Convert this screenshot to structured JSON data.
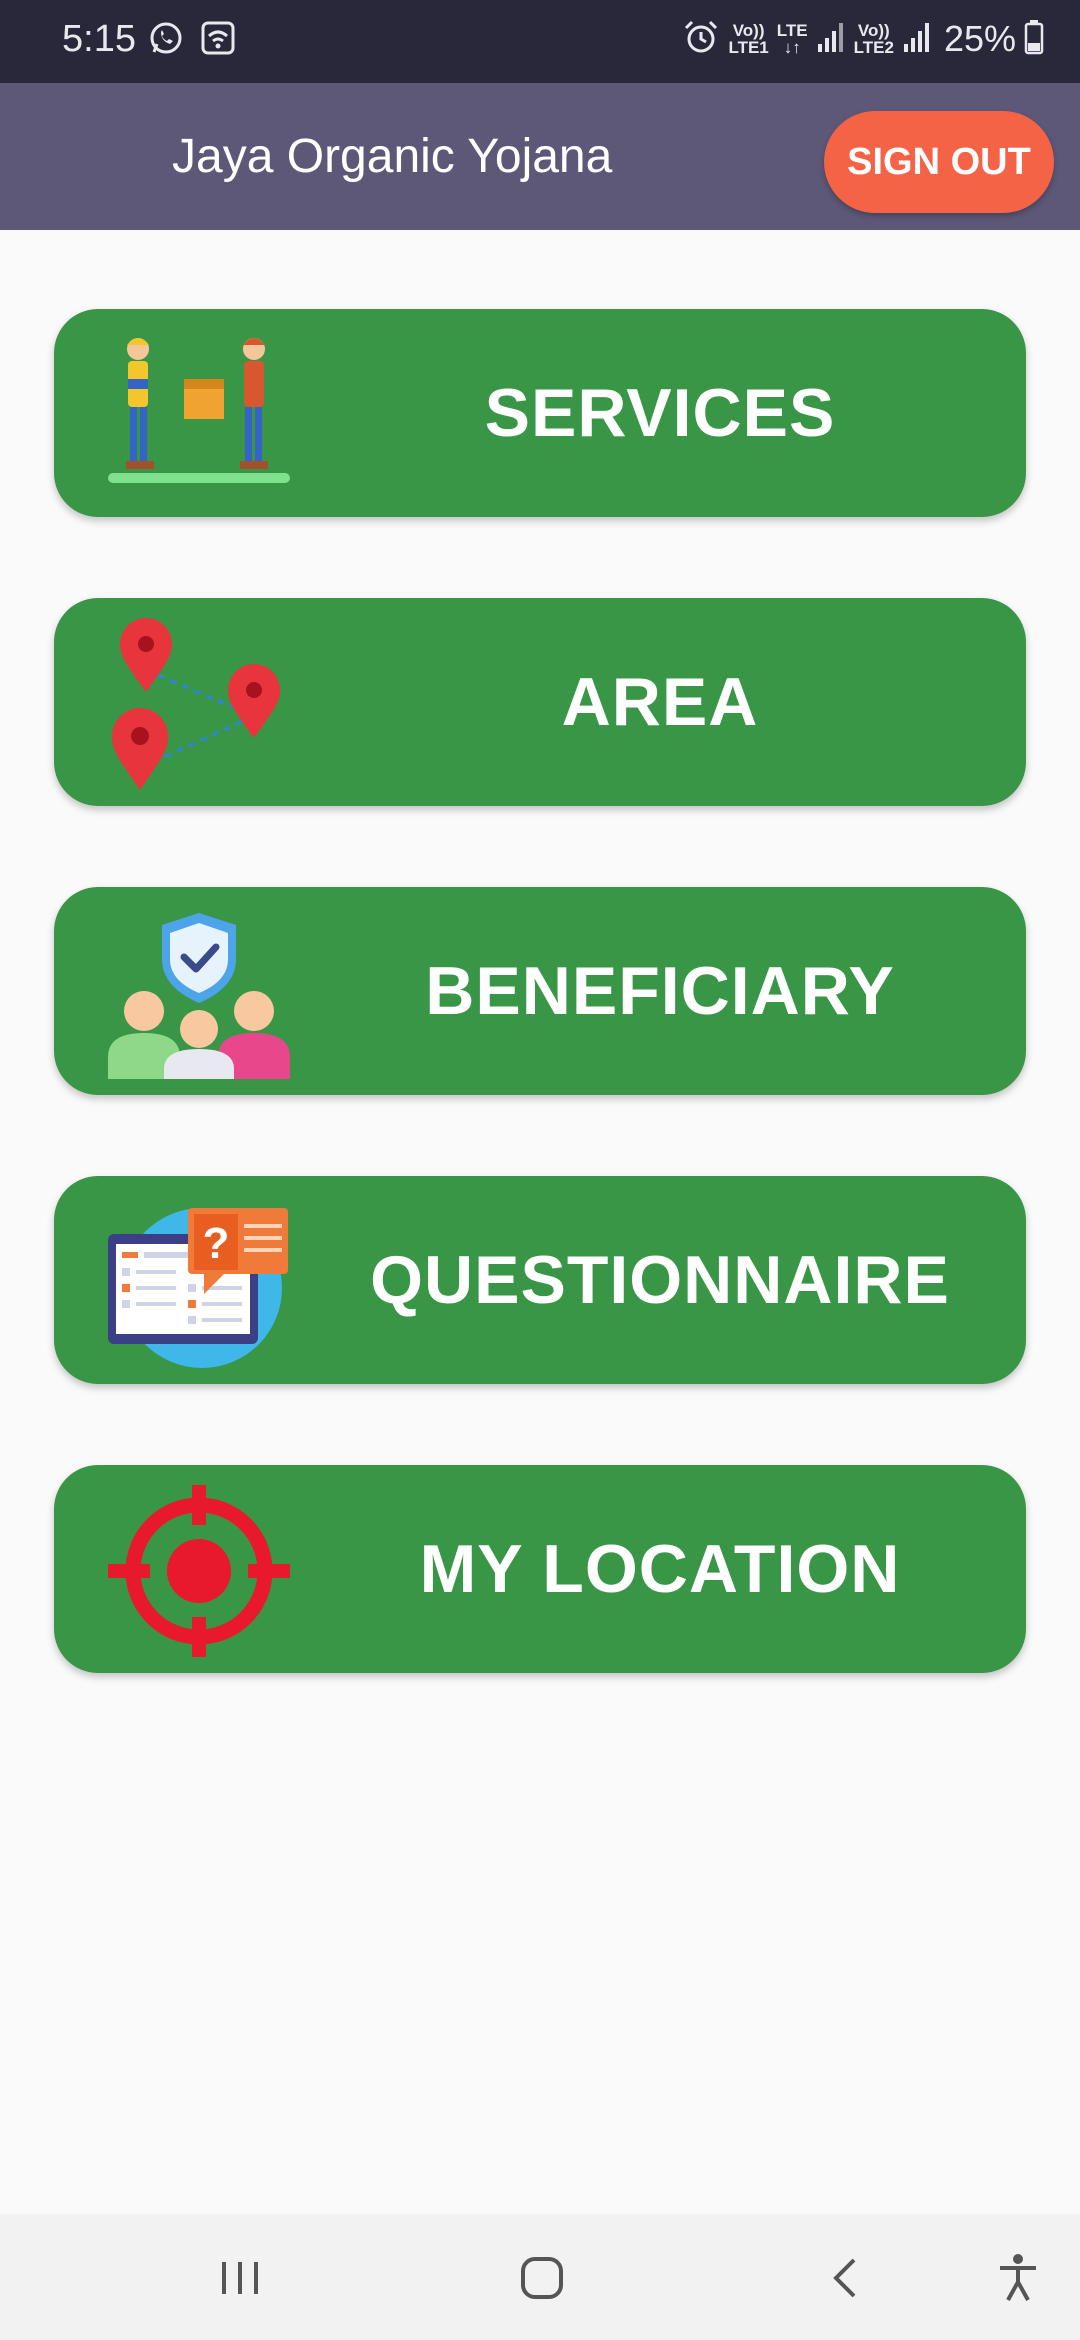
{
  "status_bar": {
    "time": "5:15",
    "sim1_top": "Vo))",
    "sim1_bottom": "LTE1",
    "lte_label": "LTE",
    "sim2_top": "Vo))",
    "sim2_bottom": "LTE2",
    "battery": "25%",
    "icons": [
      "whatsapp-icon",
      "wifi-icon",
      "alarm-icon",
      "signal-icon",
      "battery-icon"
    ]
  },
  "app_bar": {
    "title": "Jaya Organic Yojana",
    "sign_out_label": "SIGN OUT"
  },
  "menu": {
    "items": [
      {
        "label": "SERVICES",
        "icon": "delivery-people-icon"
      },
      {
        "label": "AREA",
        "icon": "map-pins-icon"
      },
      {
        "label": "BENEFICIARY",
        "icon": "beneficiary-group-icon"
      },
      {
        "label": "QUESTIONNAIRE",
        "icon": "questionnaire-icon"
      },
      {
        "label": "MY LOCATION",
        "icon": "crosshair-target-icon"
      }
    ]
  },
  "nav_bar": {
    "items": [
      "recent-apps-icon",
      "home-icon",
      "back-icon",
      "accessibility-icon"
    ]
  },
  "colors": {
    "status_bar": "#29283a",
    "app_bar": "#5d5878",
    "sign_out": "#f56347",
    "menu_button": "#3a9647",
    "background": "#fafafa"
  }
}
